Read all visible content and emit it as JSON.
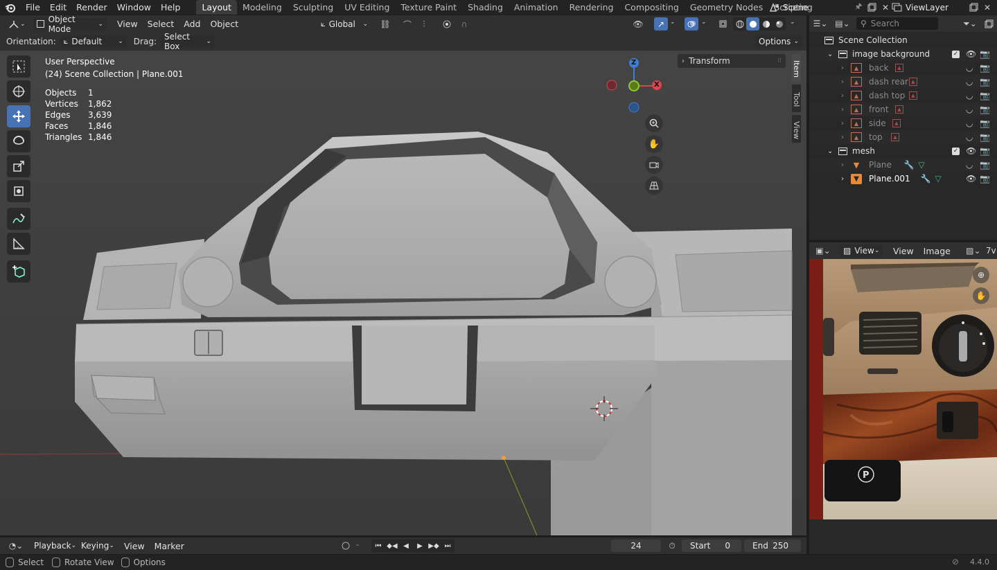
{
  "app_menu": [
    "File",
    "Edit",
    "Render",
    "Window",
    "Help"
  ],
  "workspaces": [
    "Layout",
    "Modeling",
    "Sculpting",
    "UV Editing",
    "Texture Paint",
    "Shading",
    "Animation",
    "Rendering",
    "Compositing",
    "Geometry Nodes",
    "Scripting"
  ],
  "active_workspace": "Layout",
  "scene_name": "Scene",
  "view_layer": "ViewLayer",
  "viewport_header": {
    "mode": "Object Mode",
    "menus": [
      "View",
      "Select",
      "Add",
      "Object"
    ],
    "transform_orientation": "Global"
  },
  "tool_settings": {
    "orientation_label": "Orientation:",
    "orientation_value": "Default",
    "drag_label": "Drag:",
    "drag_value": "Select Box",
    "options_label": "Options"
  },
  "overlay_text": {
    "perspective": "User Perspective",
    "collection_path": "(24) Scene Collection | Plane.001",
    "stats": [
      {
        "label": "Objects",
        "value": "1"
      },
      {
        "label": "Vertices",
        "value": "1,862"
      },
      {
        "label": "Edges",
        "value": "3,639"
      },
      {
        "label": "Faces",
        "value": "1,846"
      },
      {
        "label": "Triangles",
        "value": "1,846"
      }
    ]
  },
  "gizmo_axes": {
    "z": "Z",
    "x": "X"
  },
  "sidebar": {
    "panel_title": "Transform",
    "tabs": [
      "Item",
      "Tool",
      "View"
    ]
  },
  "outliner": {
    "search_placeholder": "Search",
    "root": "Scene Collection",
    "collections": [
      {
        "name": "image background",
        "children": [
          "back",
          "dash rear",
          "dash top",
          "front",
          "side",
          "top"
        ]
      },
      {
        "name": "mesh",
        "children": [
          "Plane",
          "Plane.001"
        ]
      }
    ]
  },
  "image_editor": {
    "view_dropdown": "View",
    "menus": [
      "View",
      "Image"
    ],
    "truncated_tab": "7v"
  },
  "timeline": {
    "menus": [
      "Playback",
      "Keying",
      "View",
      "Marker"
    ],
    "current_frame": "24",
    "start_label": "Start",
    "start_value": "0",
    "end_label": "End",
    "end_value": "250"
  },
  "statusbar": {
    "items": [
      "Select",
      "Rotate View",
      "Options"
    ],
    "version": "4.4.0"
  },
  "colors": {
    "accent": "#4772b3",
    "x_axis": "#e0434e",
    "y_axis": "#7ab51d",
    "z_axis": "#3d7fd6"
  }
}
